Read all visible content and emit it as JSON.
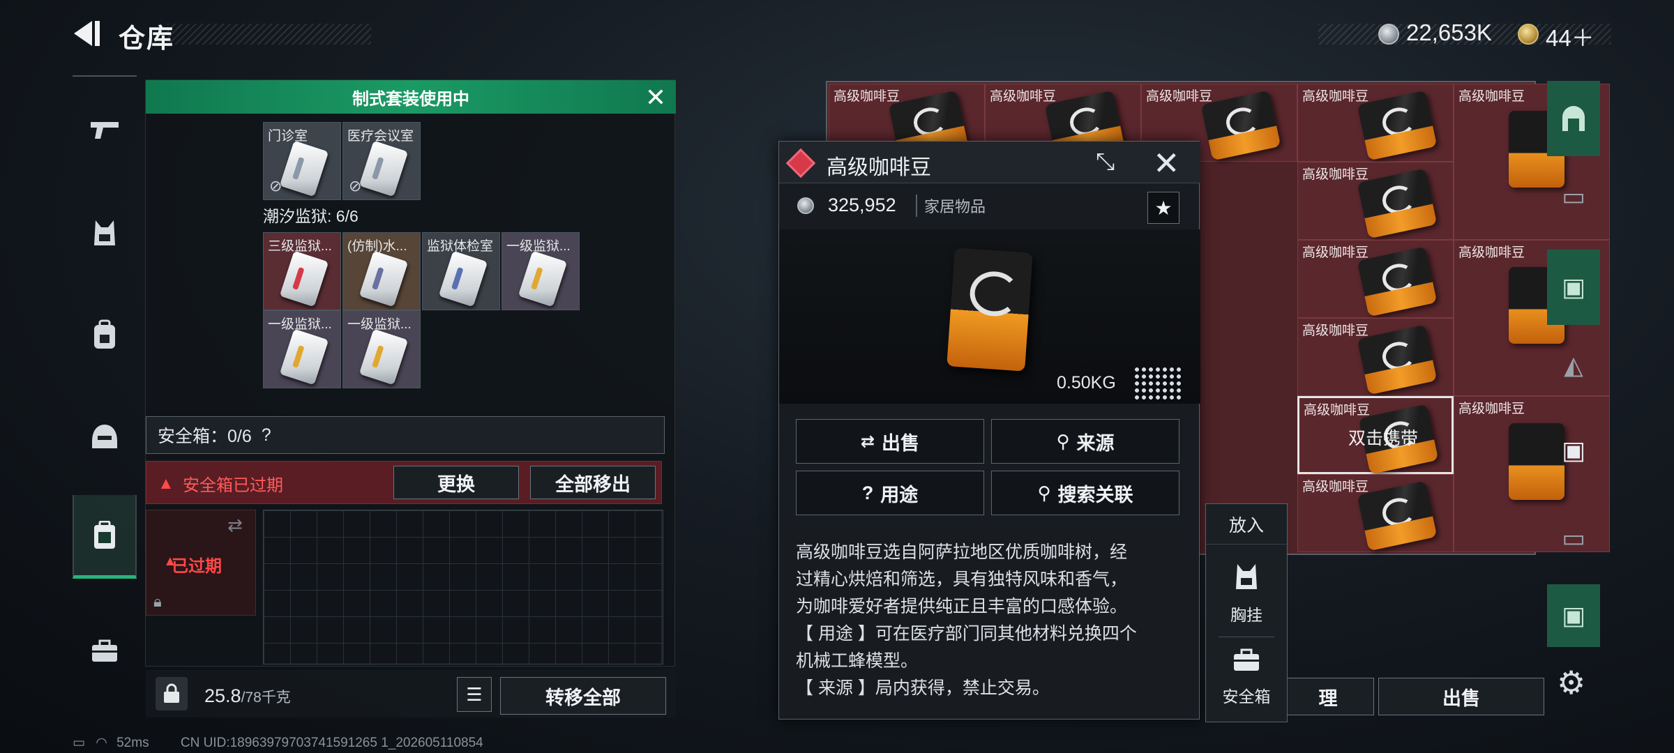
{
  "header": {
    "title": "仓库",
    "currency": "22,653K",
    "tokens": "44＋"
  },
  "left_nav": {
    "items": [
      "gun-icon",
      "vest-icon",
      "backpack-icon",
      "helmet-icon",
      "safe-case-icon",
      "toolbox-icon"
    ]
  },
  "kit_panel": {
    "banner": "制式套装使用中",
    "row1": [
      "门诊室",
      "医疗会议室"
    ],
    "prison_label": "潮汐监狱: 6/6",
    "row2": [
      "三级监狱...",
      "(仿制)水...",
      "监狱体检室",
      "一级监狱..."
    ],
    "row3": [
      "一级监狱...",
      "一级监狱..."
    ],
    "safe_box": "安全箱：0/6",
    "safe_box_help": "?",
    "expired_text": "安全箱已过期",
    "replace_button": "更换",
    "remove_all_button": "全部移出",
    "expired_item": "已过期",
    "weight": "25.8",
    "weight_max": "/78千克",
    "transfer_all_button": "转移全部"
  },
  "item_grid": {
    "item_name": "高级咖啡豆",
    "hint": "双击携带",
    "organize_button": "理",
    "sell_button": "出售"
  },
  "popup": {
    "title": "高级咖啡豆",
    "price": "325,952",
    "category": "家居物品",
    "weight": "0.50KG",
    "buttons": {
      "sell": "出售",
      "source": "来源",
      "use": "用途",
      "search_related": "搜索关联"
    },
    "description": [
      "高级咖啡豆选自阿萨拉地区优质咖啡树，经",
      "过精心烘焙和筛选，具有独特风味和香气，",
      "为咖啡爱好者提供纯正且丰富的口感体验。",
      "【 用途 】可在医疗部门同其他材料兑换四个",
      "机械工蜂模型。",
      "【 来源 】局内获得，禁止交易。"
    ]
  },
  "context_menu": {
    "header": "放入",
    "chest_rig": "胸挂",
    "safe_box": "安全箱"
  },
  "status_bar": {
    "ping": "52ms",
    "uid": "CN UID:18963979703741591265 1_202605110854"
  },
  "colors": {
    "accent_green": "#1b9a64",
    "danger_red": "#ff4a4a",
    "item_bg": "#5a272d"
  }
}
